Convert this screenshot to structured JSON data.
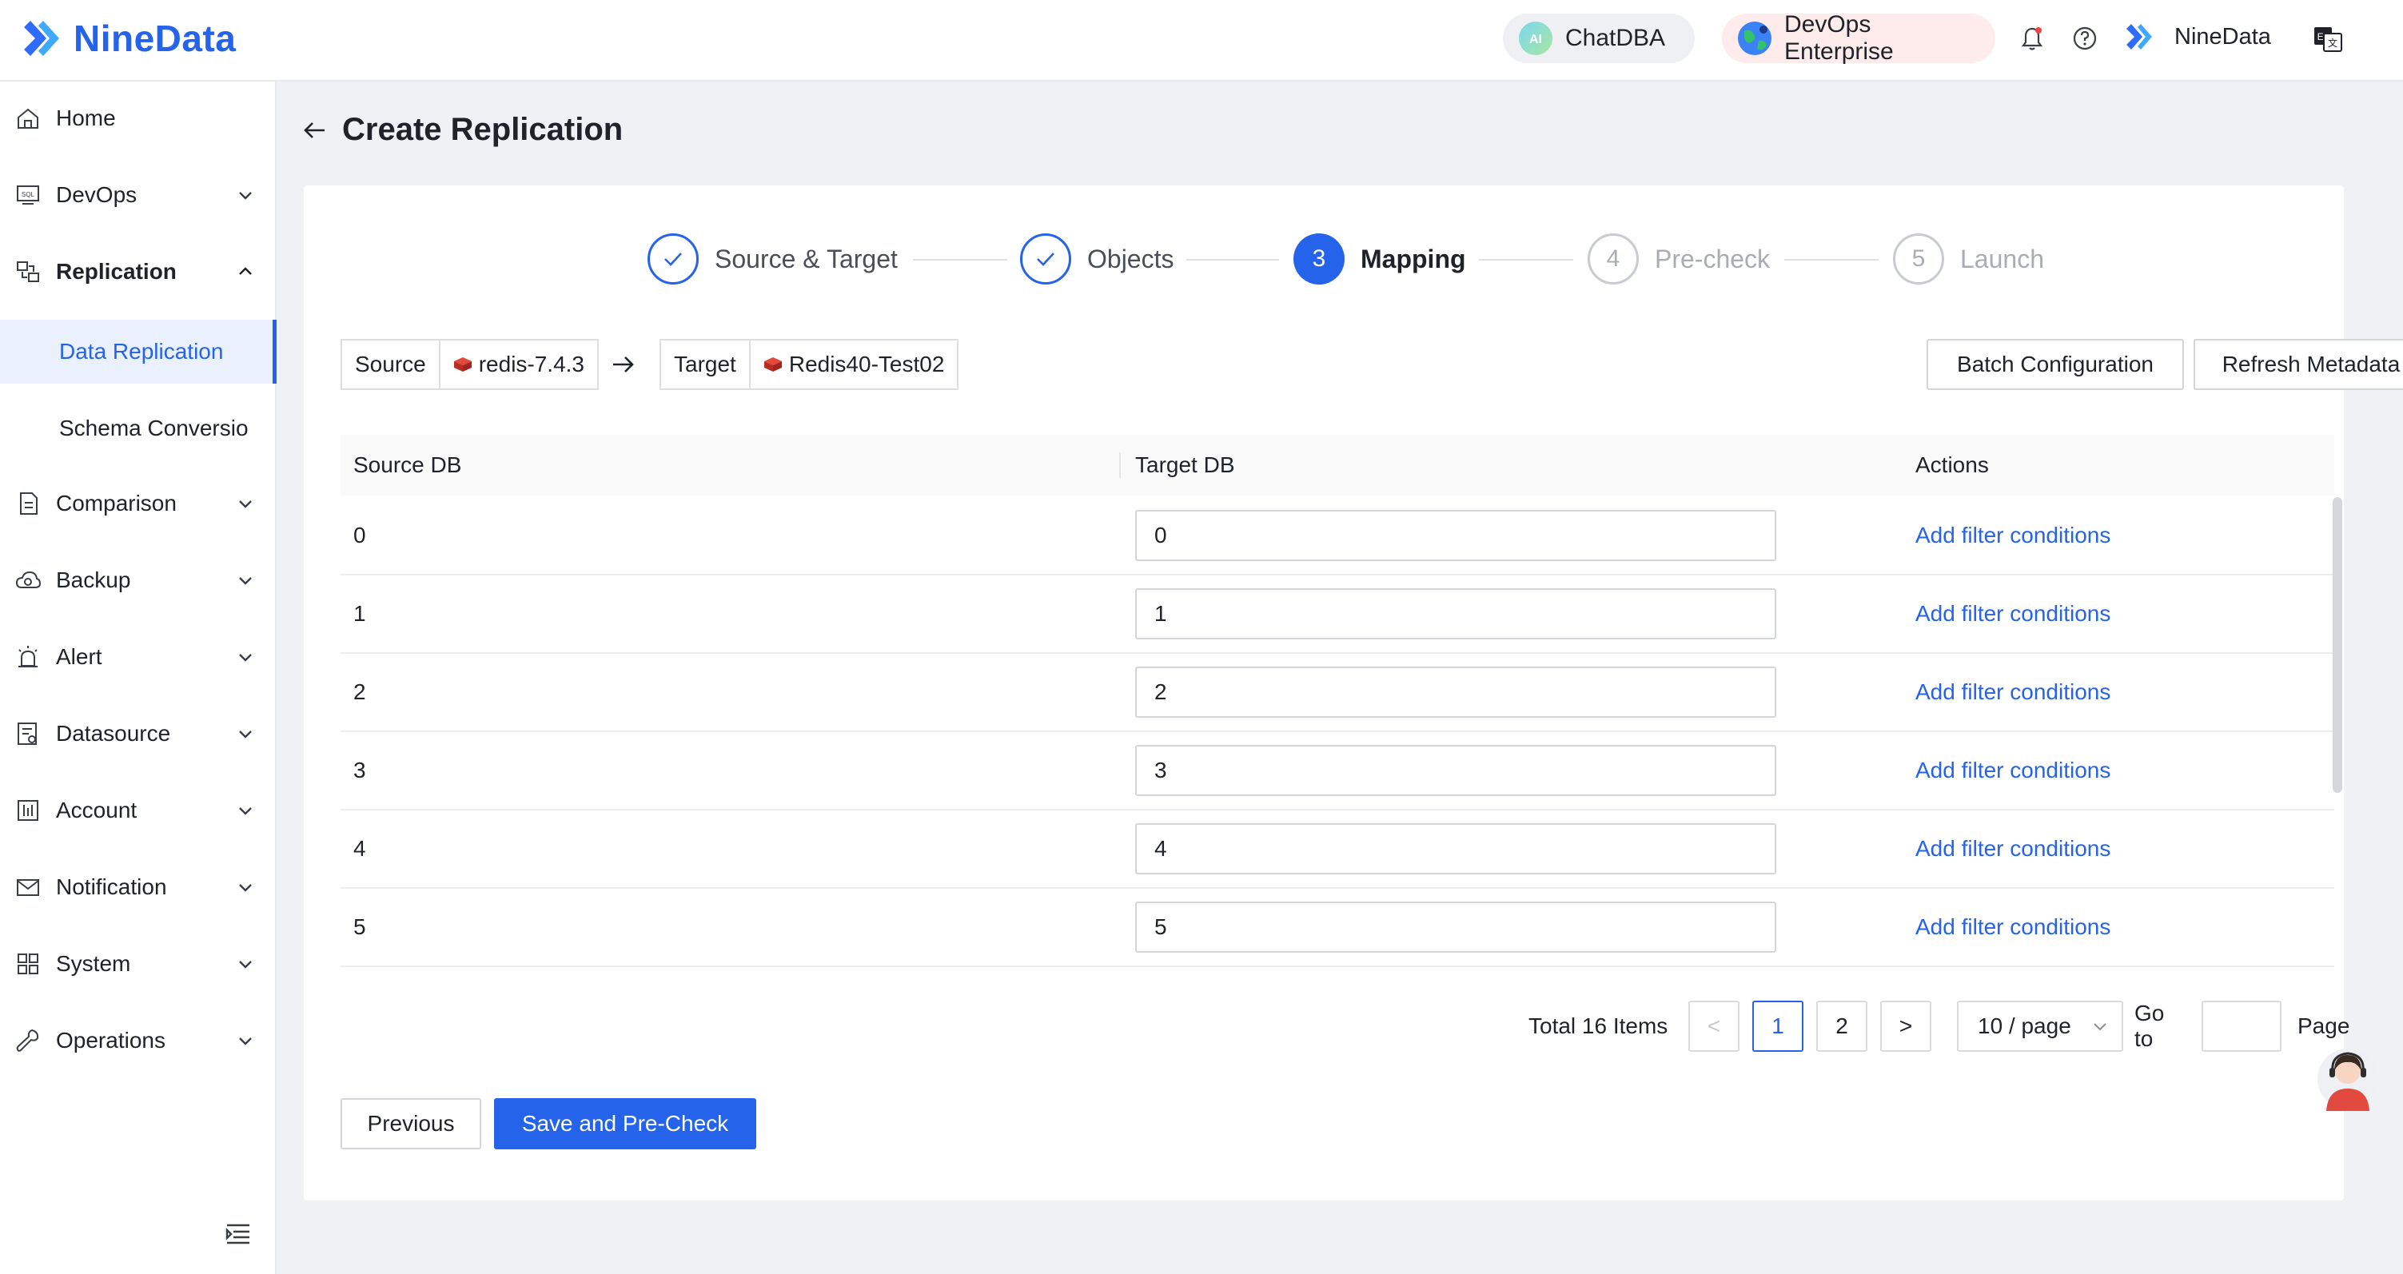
{
  "header": {
    "brand": "NineData",
    "chatdba_label": "ChatDBA",
    "edition_label": "DevOps Enterprise",
    "user_name": "NineData",
    "colors": {
      "brand": "#2563eb",
      "devops_pill_bg": "#fdeceb",
      "chat_pill_bg": "#eef0f3"
    }
  },
  "sidebar": {
    "items": [
      {
        "label": "Home",
        "icon": "home-icon",
        "expandable": false
      },
      {
        "label": "DevOps",
        "icon": "sql-console-icon",
        "expandable": true
      },
      {
        "label": "Replication",
        "icon": "replication-icon",
        "expandable": true,
        "expanded": true
      },
      {
        "label": "Comparison",
        "icon": "comparison-icon",
        "expandable": true
      },
      {
        "label": "Backup",
        "icon": "backup-cloud-icon",
        "expandable": true
      },
      {
        "label": "Alert",
        "icon": "alarm-icon",
        "expandable": true
      },
      {
        "label": "Datasource",
        "icon": "datasource-icon",
        "expandable": true
      },
      {
        "label": "Account",
        "icon": "account-icon",
        "expandable": true
      },
      {
        "label": "Notification",
        "icon": "mail-icon",
        "expandable": true
      },
      {
        "label": "System",
        "icon": "grid-icon",
        "expandable": true
      },
      {
        "label": "Operations",
        "icon": "wrench-icon",
        "expandable": true
      }
    ],
    "sub_items": [
      {
        "label": "Data Replication",
        "active": true
      },
      {
        "label": "Schema Conversio",
        "active": false
      }
    ]
  },
  "page": {
    "title": "Create Replication"
  },
  "steps": [
    {
      "number": "1",
      "label": "Source & Target",
      "state": "done"
    },
    {
      "number": "2",
      "label": "Objects",
      "state": "done"
    },
    {
      "number": "3",
      "label": "Mapping",
      "state": "current"
    },
    {
      "number": "4",
      "label": "Pre-check",
      "state": "todo"
    },
    {
      "number": "5",
      "label": "Launch",
      "state": "todo"
    }
  ],
  "connection": {
    "source_label": "Source",
    "source_value": "redis-7.4.3",
    "target_label": "Target",
    "target_value": "Redis40-Test02"
  },
  "toolbar": {
    "batch_label": "Batch Configuration",
    "refresh_label": "Refresh Metadata"
  },
  "table": {
    "columns": [
      "Source DB",
      "Target DB",
      "Actions"
    ],
    "rows": [
      {
        "source": "0",
        "target": "0",
        "action": "Add filter conditions"
      },
      {
        "source": "1",
        "target": "1",
        "action": "Add filter conditions"
      },
      {
        "source": "2",
        "target": "2",
        "action": "Add filter conditions"
      },
      {
        "source": "3",
        "target": "3",
        "action": "Add filter conditions"
      },
      {
        "source": "4",
        "target": "4",
        "action": "Add filter conditions"
      },
      {
        "source": "5",
        "target": "5",
        "action": "Add filter conditions"
      }
    ]
  },
  "pagination": {
    "total": "Total 16 Items",
    "prev": "<",
    "next": ">",
    "pages": [
      "1",
      "2"
    ],
    "current_page": "1",
    "page_size": "10 / page",
    "goto_label": "Go to",
    "goto_value": "",
    "page_suffix": "Page"
  },
  "footer": {
    "previous_label": "Previous",
    "save_label": "Save and Pre-Check"
  }
}
